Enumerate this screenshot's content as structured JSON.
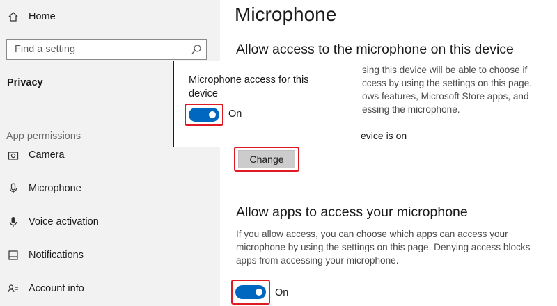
{
  "sidebar": {
    "home_label": "Home",
    "search_placeholder": "Find a setting",
    "category_title": "Privacy",
    "section_title": "App permissions",
    "items": [
      {
        "label": "Camera",
        "icon": "camera-icon"
      },
      {
        "label": "Microphone",
        "icon": "microphone-icon"
      },
      {
        "label": "Voice activation",
        "icon": "voice-activation-icon"
      },
      {
        "label": "Notifications",
        "icon": "notifications-icon"
      },
      {
        "label": "Account info",
        "icon": "account-info-icon"
      }
    ]
  },
  "main": {
    "title": "Microphone",
    "device_section": {
      "heading": "Allow access to the microphone on this device",
      "description_lines": [
        "sing this device will be able to choose if",
        "ccess by using the settings on this page.",
        "ows features, Microsoft Store apps, and",
        "essing the microphone."
      ],
      "status_text": "evice is on",
      "change_button": "Change"
    },
    "apps_section": {
      "heading": "Allow apps to access your microphone",
      "description_lines": [
        "If you allow access, you can choose which apps can access your",
        "microphone by using the settings on this page. Denying access blocks",
        "apps from accessing your microphone."
      ],
      "toggle_state": "On"
    }
  },
  "popup": {
    "title": "Microphone access for this device",
    "toggle_state": "On"
  },
  "colors": {
    "accent": "#0067c0",
    "highlight": "#e01a22",
    "sidebar_bg": "#f2f2f2"
  }
}
